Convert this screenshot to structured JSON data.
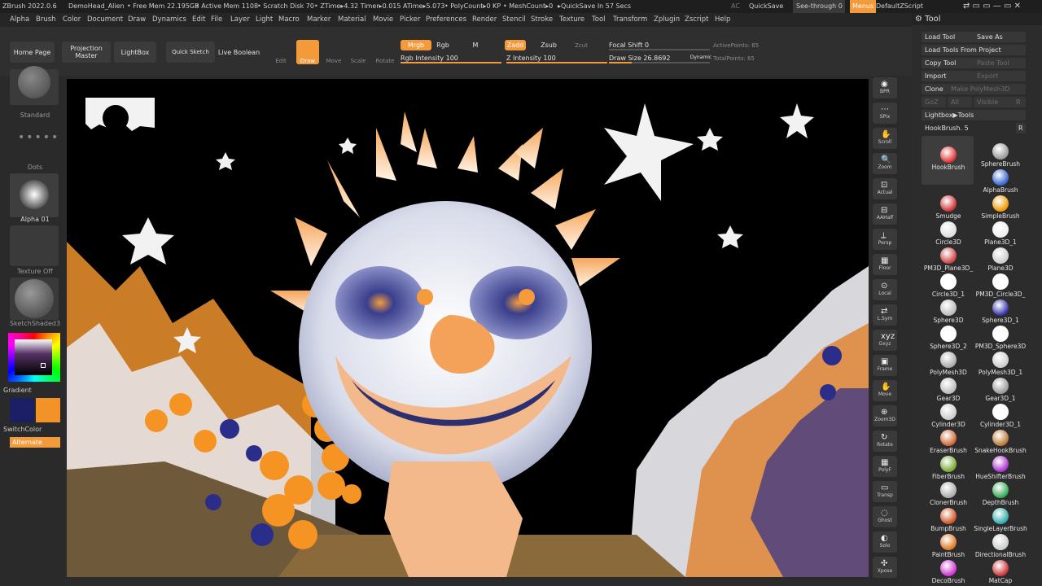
{
  "titlebar": {
    "app": "ZBrush 2022.0.6",
    "doc": "DemoHead_Alien",
    "free_mem": "• Free Mem 22.195GB",
    "active_mem": "• Active Mem 1108",
    "scratch": "• Scratch Disk 70",
    "ztime": "• ZTime▸4.32 Timer▸0.015 ATime▸5.073",
    "polycount": "• PolyCount▸0 KP",
    "meshcount": "• MeshCount▸0",
    "quicksave_in": "▸QuickSave In 57 Secs",
    "ac": "AC",
    "quicksave": "QuickSave",
    "see_through": "See-through  0",
    "menus": "Menus",
    "zscript": "DefaultZScript"
  },
  "menubar": [
    "Alpha",
    "Brush",
    "Color",
    "Document",
    "Draw",
    "Dynamics",
    "Edit",
    "File",
    "Layer",
    "Light",
    "Macro",
    "Marker",
    "Material",
    "Movie",
    "Picker",
    "Preferences",
    "Render",
    "Stencil",
    "Stroke",
    "Texture",
    "Tool",
    "Transform",
    "Zplugin",
    "Zscript",
    "Help"
  ],
  "toolbar": {
    "home": "Home Page",
    "projection": "Projection Master",
    "lightbox": "LightBox",
    "quick_sketch": "Quick Sketch",
    "live_boolean": "Live Boolean",
    "edit": "Edit",
    "draw": "Draw",
    "move": "Move",
    "scale": "Scale",
    "rotate": "Rotate",
    "mrgb": "Mrgb",
    "rgb": "Rgb",
    "m": "M",
    "rgb_intensity": "Rgb Intensity 100",
    "zadd": "Zadd",
    "zsub": "Zsub",
    "zcut": "Zcut",
    "z_intensity": "Z Intensity 100",
    "focal_shift": "Focal Shift 0",
    "draw_size": "Draw Size 26.8692",
    "dynamic": "Dynamic",
    "active_points": "ActivePoints: 65",
    "total_points": "TotalPoints: 65"
  },
  "leftshelf": {
    "standard": "Standard",
    "dots": "Dots",
    "alpha": "Alpha 01",
    "texture": "Texture Off",
    "material": "SketchShaded3",
    "gradient": "Gradient",
    "switchcolor": "SwitchColor",
    "alternate": "Alternate",
    "primary_color": "#1b1f66",
    "secondary_color": "#f4922a"
  },
  "rightshelf": [
    "BPR",
    "SPix",
    "Scroll",
    "Zoom",
    "Actual",
    "AAHalf",
    "Persp",
    "Floor",
    "Local",
    "L.Sym",
    "Gxyz",
    "Frame",
    "Move",
    "Zoom3D",
    "Rotate",
    "PolyF",
    "Transp",
    "Ghost",
    "Solo",
    "Xpose"
  ],
  "toolpanel": {
    "title": "Tool",
    "load_tool": "Load Tool",
    "save_as": "Save As",
    "load_from_project": "Load Tools From Project",
    "copy_tool": "Copy Tool",
    "paste_tool": "Paste Tool",
    "import": "Import",
    "export": "Export",
    "clone": "Clone",
    "make_polymesh": "Make PolyMesh3D",
    "goz": "GoZ",
    "all": "All",
    "visible": "Visible",
    "r": "R",
    "lightbox_tools": "Lightbox▶Tools",
    "current": "HookBrush. 5",
    "brushes": [
      {
        "name": "HookBrush",
        "color": "#d33"
      },
      {
        "name": "SphereBrush",
        "color": "#999"
      },
      {
        "name": "AlphaBrush",
        "color": "#36c"
      },
      {
        "name": "Smudge",
        "color": "#c33"
      },
      {
        "name": "SimpleBrush",
        "color": "#e90"
      },
      {
        "name": "Circle3D",
        "color": "#ddd"
      },
      {
        "name": "Plane3D_1",
        "color": "#eee"
      },
      {
        "name": "PM3D_Plane3D_",
        "color": "#c44"
      },
      {
        "name": "Plane3D",
        "color": "#ccc"
      },
      {
        "name": "Circle3D_1",
        "color": "#fff"
      },
      {
        "name": "PM3D_Circle3D_",
        "color": "#fff"
      },
      {
        "name": "Sphere3D",
        "color": "#bbb"
      },
      {
        "name": "Sphere3D_1",
        "color": "#33a"
      },
      {
        "name": "Sphere3D_2",
        "color": "#fff"
      },
      {
        "name": "PM3D_Sphere3D",
        "color": "#fff"
      },
      {
        "name": "PolyMesh3D",
        "color": "#aaa"
      },
      {
        "name": "PolyMesh3D_1",
        "color": "#ccc"
      },
      {
        "name": "Gear3D",
        "color": "#bbb"
      },
      {
        "name": "Gear3D_1",
        "color": "#999"
      },
      {
        "name": "Cylinder3D",
        "color": "#ccc"
      },
      {
        "name": "Cylinder3D_1",
        "color": "#fff"
      },
      {
        "name": "EraserBrush",
        "color": "#c63"
      },
      {
        "name": "SnakeHookBrush",
        "color": "#b73"
      },
      {
        "name": "FiberBrush",
        "color": "#7a3"
      },
      {
        "name": "HueShifterBrush",
        "color": "#a3c"
      },
      {
        "name": "ClonerBrush",
        "color": "#aaa"
      },
      {
        "name": "DepthBrush",
        "color": "#3a5"
      },
      {
        "name": "BumpBrush",
        "color": "#c52"
      },
      {
        "name": "SingleLayerBrush",
        "color": "#3aa"
      },
      {
        "name": "PaintBrush",
        "color": "#d72"
      },
      {
        "name": "DirectionalBrush",
        "color": "#ccc"
      },
      {
        "name": "DecoBrush",
        "color": "#c3c"
      },
      {
        "name": "MatCap",
        "color": "#c33"
      }
    ]
  }
}
